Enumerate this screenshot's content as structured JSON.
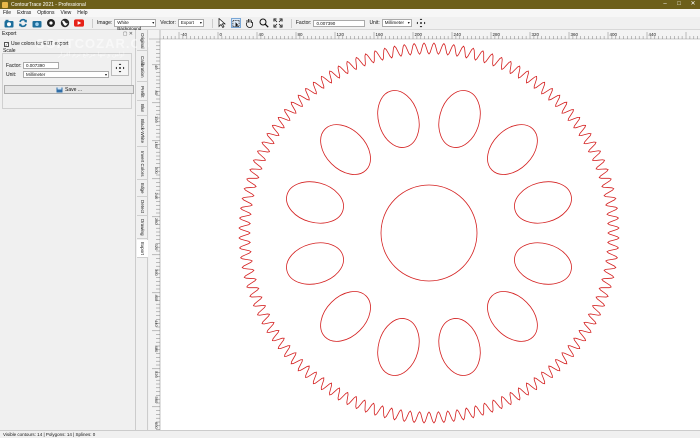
{
  "window": {
    "title": "ContourTrace 2021 - Professional",
    "min": "–",
    "max": "□",
    "close": "✕"
  },
  "menu": [
    "File",
    "Extras",
    "Options",
    "View",
    "Help"
  ],
  "toolbar": {
    "image_label": "Image:",
    "image_value": "White Background",
    "vector_label": "Vector:",
    "vector_value": "Export",
    "factor_label": "Factor:",
    "factor_value": "0.007390",
    "unit_label": "Unit:",
    "unit_value": "Millimeter"
  },
  "panel": {
    "title": "Export",
    "controls": "▢ ✕",
    "checkbox_label": "Use colors for EDT export",
    "checked": true,
    "scale_label": "Scale",
    "factor_label": "Factor:",
    "factor_value": "0.007390",
    "unit_label": "Unit:",
    "unit_value": "Millimeter",
    "save_label": "Save ..."
  },
  "side_tabs": [
    "Original",
    "Calibration",
    "Prefilt",
    "Blur",
    "Black-White",
    "Invert Colors",
    "Edge",
    "Detect",
    "Drawing",
    "Export"
  ],
  "active_tab": "Export",
  "ruler": {
    "top_labels": [
      "-40",
      "0",
      "40",
      "80",
      "120",
      "160",
      "200",
      "240",
      "280",
      "320",
      "360",
      "400",
      "440"
    ],
    "left_labels": [
      "40",
      "80",
      "120",
      "160",
      "200",
      "240",
      "280",
      "320",
      "360",
      "400",
      "440",
      "480",
      "520",
      "560",
      "600"
    ]
  },
  "drawing": {
    "stroke_color": "#d42020",
    "teeth": 120,
    "holes": 12
  },
  "status": "Visible contours: 14  |  Polygons: 14  |  Splines: 0",
  "watermark": {
    "main": "SOFTCOZAR.COM",
    "sub": "اولین و تنها مرجع نرم افزار"
  }
}
